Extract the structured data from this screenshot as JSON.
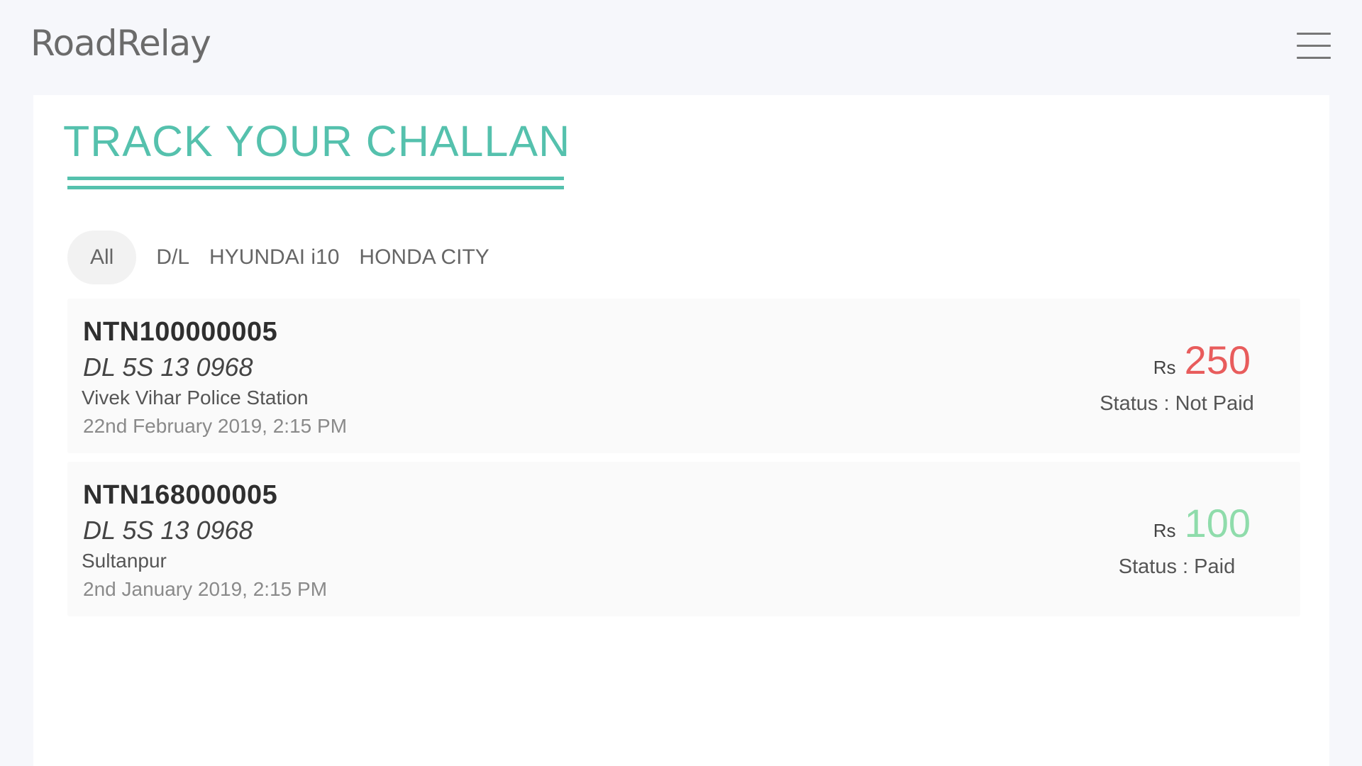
{
  "app": {
    "brand": "RoadRelay",
    "menu_icon": "hamburger-menu-icon"
  },
  "page": {
    "title": "TRACK YOUR CHALLAN"
  },
  "tabs": [
    {
      "label": "All",
      "active": true
    },
    {
      "label": "D/L",
      "active": false
    },
    {
      "label": "HYUNDAI i10",
      "active": false
    },
    {
      "label": "HONDA CITY",
      "active": false
    }
  ],
  "challans": [
    {
      "number": "NTN100000005",
      "vehicle": "DL 5S 13 0968",
      "location": "Vivek Vihar Police Station",
      "datetime": "22nd February 2019, 2:15 PM",
      "currency": "Rs",
      "amount": "250",
      "status": "Status : Not Paid"
    },
    {
      "number": "NTN168000005",
      "vehicle": "DL 5S 13 0968",
      "location": "Sultanpur",
      "datetime": "2nd January 2019, 2:15 PM",
      "currency": "Rs",
      "amount": "100",
      "status": "Status : Paid"
    }
  ],
  "colors": {
    "accent": "#55c1ad",
    "unpaid": "#e85c5c",
    "paid": "#8fdcab",
    "background": "#f6f7fb"
  }
}
